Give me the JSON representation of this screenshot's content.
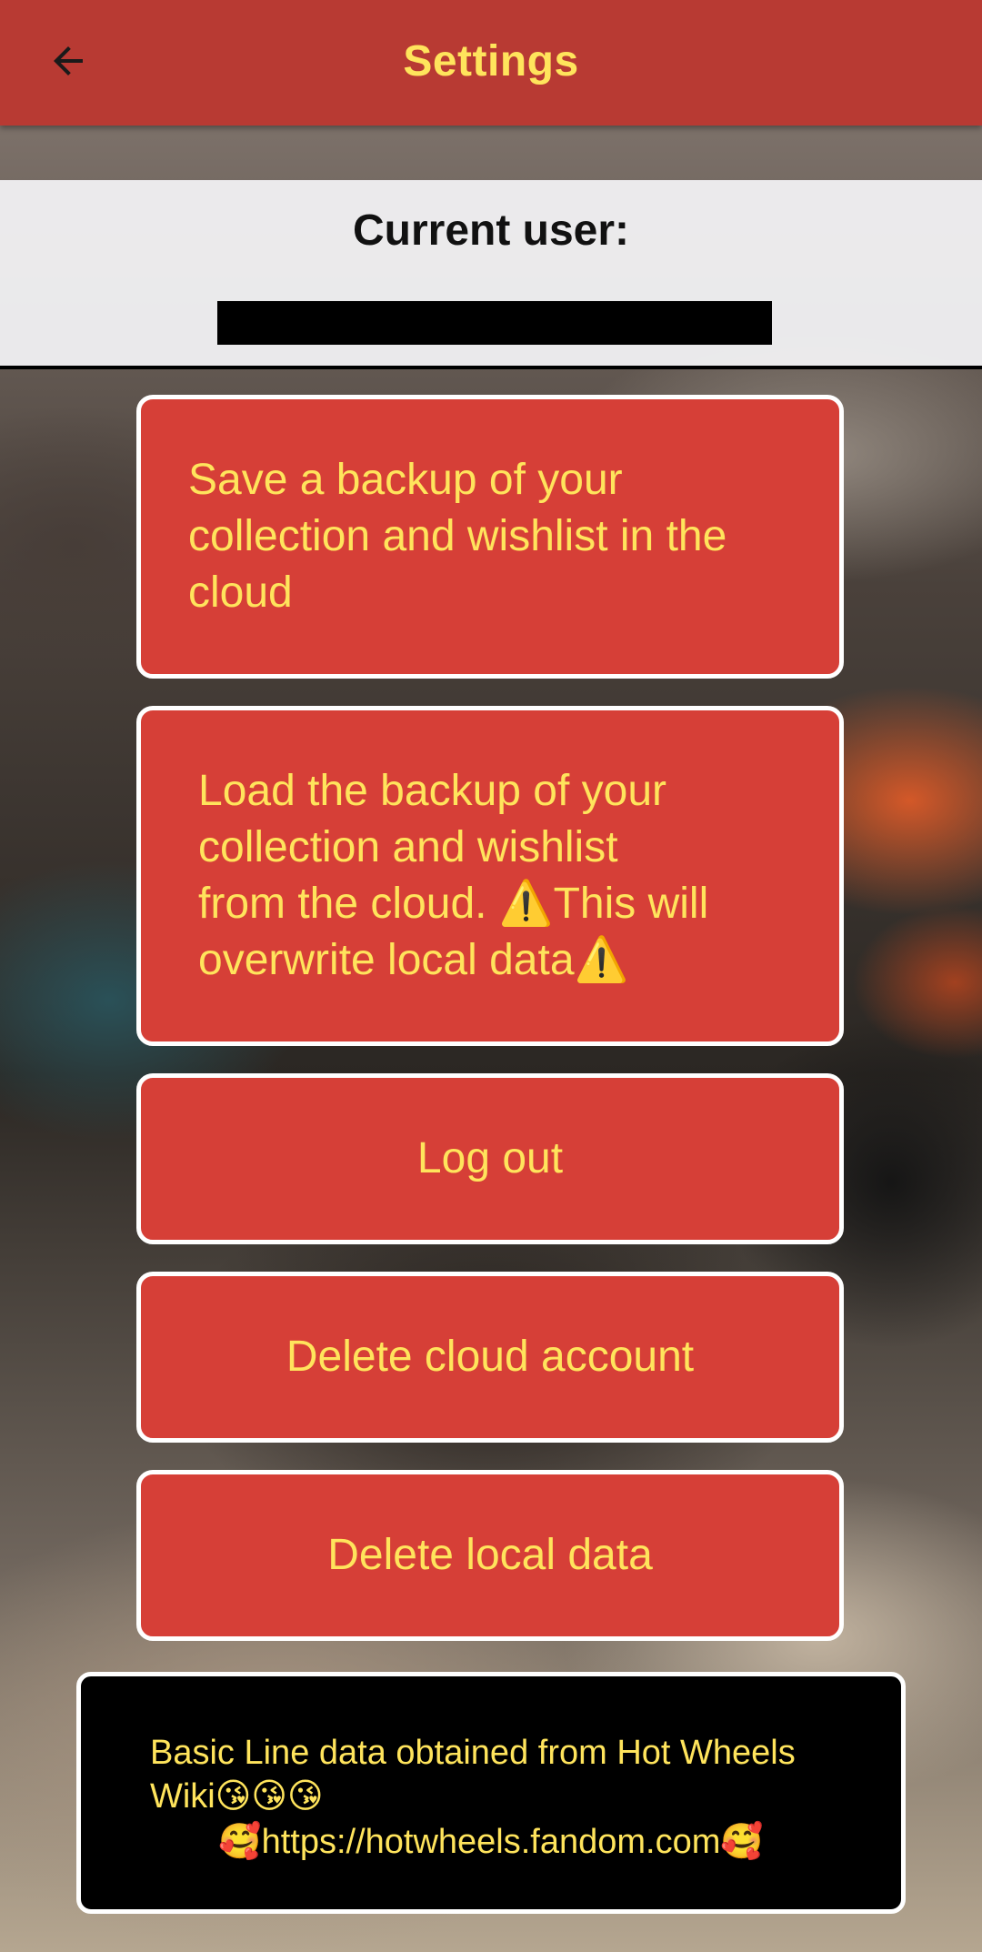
{
  "colors": {
    "appbar_bg": "#b83a33",
    "button_bg": "#d63f37",
    "accent_text": "#ffe45c",
    "button_border": "#ffffff"
  },
  "header": {
    "title": "Settings",
    "back_icon": "arrow-back-icon"
  },
  "user_panel": {
    "label": "Current user:",
    "value": ""
  },
  "buttons": {
    "save_backup": "Save a backup of your\ncollection and wishlist in the\ncloud",
    "load_backup": "Load the backup of your\ncollection and wishlist\nfrom the cloud. ⚠️This will\noverwrite local data⚠️",
    "log_out": "Log out",
    "delete_cloud_account": "Delete cloud account",
    "delete_local_data": "Delete local data"
  },
  "credits": {
    "line1": "Basic Line data obtained from Hot Wheels\nWiki😘😘😘",
    "line2": "🥰https://hotwheels.fandom.com🥰"
  }
}
